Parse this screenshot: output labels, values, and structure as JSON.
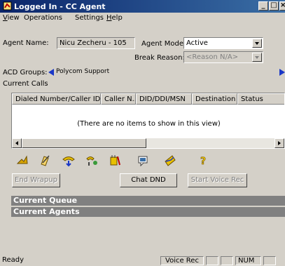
{
  "window": {
    "title": "Logged In - CC Agent"
  },
  "menu": [
    {
      "label": "View",
      "u": "V",
      "rest": "iew"
    },
    {
      "label": "Operations",
      "u": "",
      "rest": "Operations"
    },
    {
      "label": "Settings",
      "u": "",
      "rest": "Settings"
    },
    {
      "label": "Help",
      "u": "H",
      "rest": "elp"
    }
  ],
  "agent": {
    "name_label": "Agent Name:",
    "name_value": "Nicu Zecheru - 105",
    "mode_label": "Agent Mode:",
    "mode_value": "Active",
    "break_label": "Break Reason:",
    "break_value": "<Reason N/A>"
  },
  "acd": {
    "label": "ACD Groups:",
    "group": "Polycom Support"
  },
  "calls": {
    "label": "Current Calls",
    "columns": [
      "Dialed Number/Caller ID",
      "Caller N...",
      "DID/DDI/MSN",
      "Destination",
      "Status"
    ],
    "empty_text": "(There are no items to show in this view)"
  },
  "toolbar_icons": [
    "answer-call-icon",
    "notes-icon",
    "phone-transfer-icon",
    "conference-icon",
    "dnd-icon",
    "chat-icon",
    "mail-icon",
    "help-icon"
  ],
  "buttons": {
    "end_wrapup": "End Wrapup",
    "chat_dnd": "Chat DND",
    "start_voice_rec": "Start Voice Rec"
  },
  "sections": {
    "queue": "Current Queue",
    "agents": "Current Agents"
  },
  "status": {
    "ready": "Ready",
    "voice_rec": "Voice Rec",
    "num": "NUM"
  }
}
